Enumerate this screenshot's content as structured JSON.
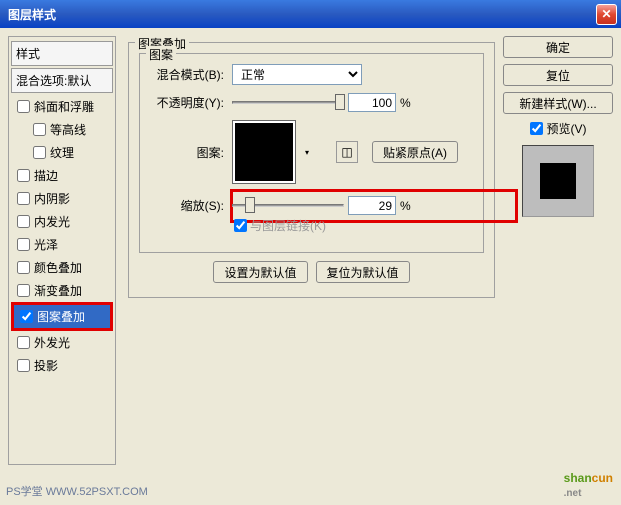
{
  "title": "图层样式",
  "left": {
    "header": "样式",
    "blend_defaults": "混合选项:默认",
    "items": [
      {
        "label": "斜面和浮雕",
        "checked": false,
        "sub": false
      },
      {
        "label": "等高线",
        "checked": false,
        "sub": true
      },
      {
        "label": "纹理",
        "checked": false,
        "sub": true
      },
      {
        "label": "描边",
        "checked": false,
        "sub": false
      },
      {
        "label": "内阴影",
        "checked": false,
        "sub": false
      },
      {
        "label": "内发光",
        "checked": false,
        "sub": false
      },
      {
        "label": "光泽",
        "checked": false,
        "sub": false
      },
      {
        "label": "颜色叠加",
        "checked": false,
        "sub": false
      },
      {
        "label": "渐变叠加",
        "checked": false,
        "sub": false
      },
      {
        "label": "图案叠加",
        "checked": true,
        "sub": false,
        "selected": true
      },
      {
        "label": "外发光",
        "checked": false,
        "sub": false
      },
      {
        "label": "投影",
        "checked": false,
        "sub": false
      }
    ]
  },
  "main": {
    "section_title": "图案叠加",
    "inner_title": "图案",
    "blend_mode_label": "混合模式(B):",
    "blend_mode_value": "正常",
    "opacity_label": "不透明度(Y):",
    "opacity_value": "100",
    "opacity_unit": "%",
    "pattern_label": "图案:",
    "snap_origin": "贴紧原点(A)",
    "scale_label": "缩放(S):",
    "scale_value": "29",
    "scale_unit": "%",
    "link_layer": "与图层链接(K)",
    "set_default": "设置为默认值",
    "reset_default": "复位为默认值"
  },
  "right": {
    "ok": "确定",
    "reset": "复位",
    "new_style": "新建样式(W)...",
    "preview": "预览(V)"
  },
  "watermark1": "PS学堂  WWW.52PSXT.COM",
  "watermark2a": "shan",
  "watermark2b": "cun",
  "watermark2c": ".net"
}
